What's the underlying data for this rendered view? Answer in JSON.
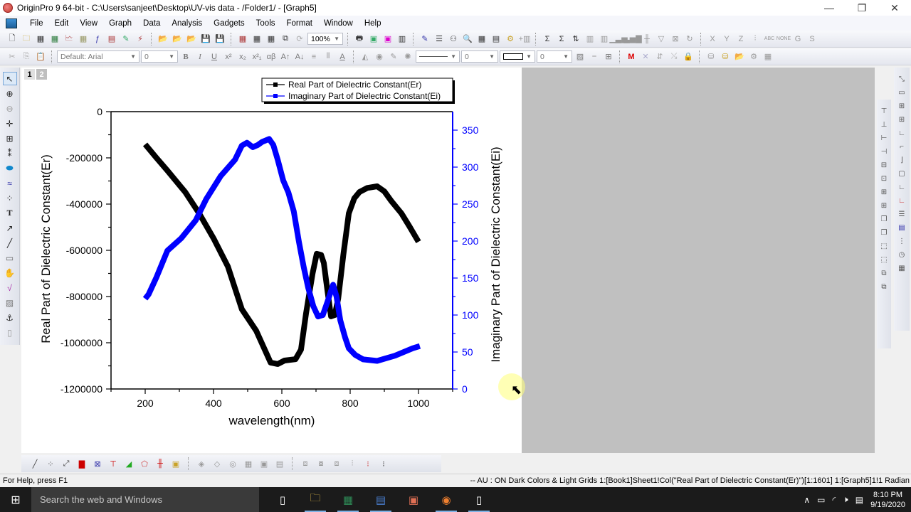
{
  "window": {
    "title": "OriginPro 9 64-bit - C:\\Users\\sanjeet\\Desktop\\UV-vis data - /Folder1/ - [Graph5]",
    "controls": {
      "minimize": "—",
      "restore": "❐",
      "close": "✕"
    },
    "mdi_controls": {
      "minimize": "‒",
      "restore": "🗗",
      "close": "✕"
    }
  },
  "menubar": {
    "items": [
      "File",
      "Edit",
      "View",
      "Graph",
      "Data",
      "Analysis",
      "Gadgets",
      "Tools",
      "Format",
      "Window",
      "Help"
    ]
  },
  "toolbar_standard": {
    "zoom_value": "100%",
    "icons": [
      "new-project",
      "new-folder",
      "new-workbook",
      "new-excel",
      "new-graph",
      "new-matrix",
      "new-function",
      "new-layout",
      "new-notes",
      "new-script",
      "open",
      "open-template",
      "open-excel",
      "save-project",
      "save-template",
      "import-wizard",
      "import-ascii",
      "import-multiple",
      "duplicate",
      "recalculate",
      "print",
      "slide-show",
      "color-picker",
      "view-frames",
      "code-builder",
      "results-log",
      "project-explorer",
      "message-log",
      "script-window",
      "command-window",
      "custom-routine",
      "add-column",
      "statistics-on-columns",
      "statistics-on-rows",
      "sort",
      "set-column-values",
      "fill-row",
      "bar-chart",
      "column-chart",
      "high-low",
      "filter",
      "clear-filter",
      "reapply-filter",
      "set-as-x",
      "set-as-y",
      "set-as-z",
      "set-as-error",
      "set-as-label",
      "disregard",
      "set-as-group",
      "set-as-subject"
    ]
  },
  "toolbar_format": {
    "font_name": "Default: Arial",
    "font_size": "0",
    "bold": "B",
    "italic": "I",
    "underline": "U",
    "superscript": "x²",
    "subscript": "x₂",
    "supersub": "x²₁",
    "greek": "αβ",
    "increase_font": "A↑",
    "decrease_font": "A↓",
    "line_width": "0",
    "border_width": "0"
  },
  "left_tools": [
    "pointer",
    "zoom-in",
    "zoom-out",
    "screen-reader",
    "data-selector",
    "data-reader",
    "region-select",
    "mask",
    "draw-data",
    "text",
    "arrow",
    "line",
    "rectangle",
    "pan",
    "insert-equation",
    "insert-graph",
    "scale-in",
    "move-layer"
  ],
  "layer_tabs": [
    "1",
    "2"
  ],
  "chart_data": {
    "type": "line",
    "title": "",
    "xlabel": "wavelength(nm)",
    "ylabel": "Real Part of Dielectric Constant(Er)",
    "y2label": "Imaginary Part of Dielectric Constant(Ei)",
    "xlim": [
      100,
      1100
    ],
    "ylim": [
      -1200000,
      0
    ],
    "y2lim": [
      0,
      350
    ],
    "x_ticks": [
      200,
      400,
      600,
      800,
      1000
    ],
    "x_tick_labels": [
      "200",
      "400",
      "600",
      "800",
      "1000"
    ],
    "y_ticks": [
      0,
      -200000,
      -400000,
      -600000,
      -800000,
      -1000000,
      -1200000
    ],
    "y_tick_labels": [
      "0",
      "-200000",
      "-400000",
      "-600000",
      "-800000",
      "-1000000",
      "-1200000"
    ],
    "y2_ticks": [
      0,
      50,
      100,
      150,
      200,
      250,
      300,
      350
    ],
    "y2_tick_labels": [
      "0",
      "50",
      "100",
      "150",
      "200",
      "250",
      "300",
      "350"
    ],
    "grid": false,
    "legend_position": "top-center",
    "series": [
      {
        "name": "Real Part of Dielectric Constant(Er)",
        "axis": "left",
        "color": "#000000",
        "x": [
          200,
          233,
          265,
          317,
          358,
          400,
          442,
          483,
          525,
          567,
          588,
          608,
          640,
          656,
          671,
          690,
          702,
          715,
          723,
          734,
          744,
          755,
          765,
          780,
          796,
          812,
          827,
          850,
          879,
          900,
          921,
          950,
          973,
          1000
        ],
        "y": [
          -141500,
          -200000,
          -255000,
          -348000,
          -440000,
          -548000,
          -670000,
          -855000,
          -948000,
          -1086000,
          -1092000,
          -1077000,
          -1071000,
          -1030000,
          -871000,
          -700000,
          -615000,
          -620000,
          -655000,
          -780000,
          -886000,
          -880000,
          -809000,
          -620000,
          -440000,
          -375000,
          -348000,
          -330000,
          -323000,
          -345000,
          -388000,
          -440000,
          -495000,
          -563000
        ]
      },
      {
        "name": "Imaginary Part of Dielectric Constant(Ei)",
        "axis": "right",
        "color": "#0000ff",
        "x": [
          200,
          210,
          233,
          265,
          306,
          348,
          379,
          421,
          463,
          483,
          498,
          515,
          530,
          542,
          563,
          575,
          588,
          604,
          619,
          635,
          650,
          664,
          677,
          692,
          706,
          720,
          733,
          742,
          750,
          760,
          771,
          785,
          796,
          815,
          838,
          879,
          931,
          983,
          1004
        ],
        "y": [
          122,
          128,
          151,
          187,
          204,
          228,
          257,
          288,
          310,
          329,
          333,
          327,
          330,
          334,
          338,
          330,
          310,
          282,
          266,
          240,
          199,
          165,
          137,
          112,
          98,
          100,
          117,
          130,
          141,
          125,
          93,
          70,
          55,
          46,
          40,
          38,
          45,
          55,
          58
        ]
      }
    ]
  },
  "bottom_tools": [
    "line-plot",
    "scatter-plot",
    "line-symbol",
    "column-chart",
    "box-chart",
    "error-bar",
    "area-chart",
    "pie-chart",
    "high-low-close",
    "template-library",
    "3d-surface",
    "3d-wire",
    "contour",
    "image-plot",
    "heat-map",
    "stack",
    "merge-graph",
    "arrange-layers",
    "extract-layers",
    "add-layer",
    "new-layer"
  ],
  "statusbar": {
    "help": "For Help, press F1",
    "info": "-- AU : ON  Dark Colors & Light Grids  1:[Book1]Sheet1!Col(\"Real Part of Dielectric Constant(Er)\")[1:1601]  1:[Graph5]1!1  Radian"
  },
  "taskbar": {
    "search_placeholder": "Search the web and Windows",
    "apps": [
      "task-view",
      "file-explorer",
      "excel",
      "word",
      "powerpoint",
      "origin",
      "notepad"
    ],
    "time": "8:10 PM",
    "date": "9/19/2020"
  }
}
